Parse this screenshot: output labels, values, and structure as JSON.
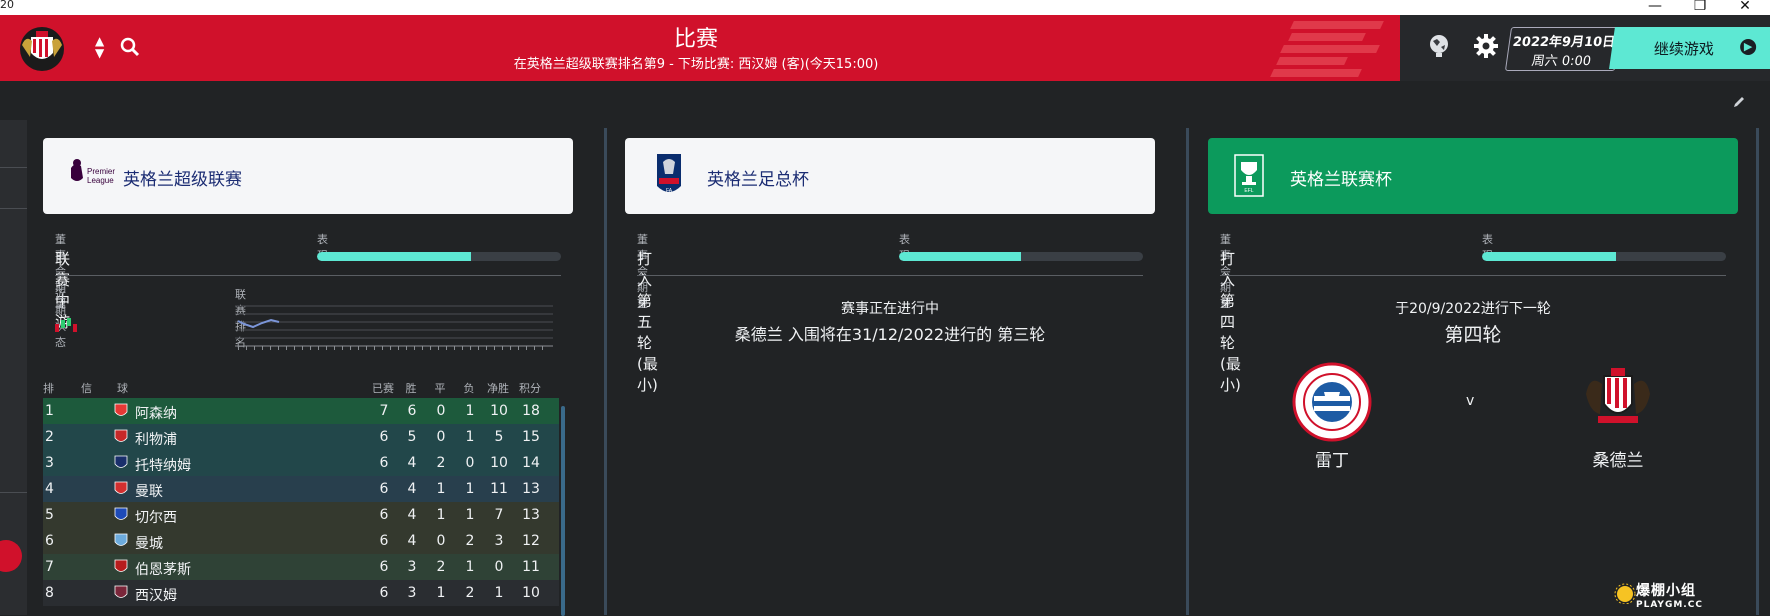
{
  "window": {
    "corner_text": "20",
    "minimize": "—",
    "restore": "❐",
    "close": "✕"
  },
  "header": {
    "title": "比赛",
    "subtitle": "在英格兰超级联赛排名第9 - 下场比赛: 西汉姆 (客)(今天15:00)",
    "date": "2022年9月10日",
    "time": "周六 0:00",
    "continue_label": "继续游戏",
    "icons": [
      "club-crest-icon",
      "nav-arrows-icon",
      "search-icon",
      "world-ball-icon",
      "settings-gear-icon",
      "chevron-right-icon"
    ]
  },
  "colors": {
    "header_red": "#d0112b",
    "accent_teal": "#5de8d3",
    "league_cup_green": "#0c9a5c",
    "background": "#212325"
  },
  "premier_league": {
    "name": "英格兰超级联赛",
    "logo_text": "Premier League",
    "expectation_label": "董事会期望",
    "expectation": "联赛中游",
    "performance_label": "表现",
    "performance": 0.63,
    "form_label": "近期状态",
    "position_label": "联赛排名",
    "table_headers": {
      "pos": "排名",
      "info": "信息",
      "team": "球队",
      "played": "已赛",
      "won": "胜",
      "drawn": "平",
      "lost": "负",
      "gd": "净胜",
      "pts": "积分"
    },
    "table": [
      {
        "pos": "1",
        "team": "阿森纳",
        "p": "7",
        "w": "6",
        "d": "0",
        "l": "1",
        "gd": "10",
        "pts": "18",
        "color": "#e53935"
      },
      {
        "pos": "2",
        "team": "利物浦",
        "p": "6",
        "w": "5",
        "d": "0",
        "l": "1",
        "gd": "5",
        "pts": "15",
        "color": "#c62828"
      },
      {
        "pos": "3",
        "team": "托特纳姆",
        "p": "6",
        "w": "4",
        "d": "2",
        "l": "0",
        "gd": "10",
        "pts": "14",
        "color": "#1a2f6b"
      },
      {
        "pos": "4",
        "team": "曼联",
        "p": "6",
        "w": "4",
        "d": "1",
        "l": "1",
        "gd": "11",
        "pts": "13",
        "color": "#d32f2f"
      },
      {
        "pos": "5",
        "team": "切尔西",
        "p": "6",
        "w": "4",
        "d": "1",
        "l": "1",
        "gd": "7",
        "pts": "13",
        "color": "#1e4bb8"
      },
      {
        "pos": "6",
        "team": "曼城",
        "p": "6",
        "w": "4",
        "d": "0",
        "l": "2",
        "gd": "3",
        "pts": "12",
        "color": "#6cabdd"
      },
      {
        "pos": "7",
        "team": "伯恩茅斯",
        "p": "6",
        "w": "3",
        "d": "2",
        "l": "1",
        "gd": "0",
        "pts": "11",
        "color": "#b71c1c"
      },
      {
        "pos": "8",
        "team": "西汉姆",
        "p": "6",
        "w": "3",
        "d": "1",
        "l": "2",
        "gd": "1",
        "pts": "10",
        "color": "#7a263a"
      }
    ]
  },
  "fa_cup": {
    "name": "英格兰足总杯",
    "expectation_label": "董事会期望",
    "expectation": "打入 第五轮 (最小)",
    "performance_label": "表现",
    "performance": 0.5,
    "status": "赛事正在进行中",
    "detail": "桑德兰 入围将在31/12/2022进行的 第三轮"
  },
  "league_cup": {
    "name": "英格兰联赛杯",
    "expectation_label": "董事会期望",
    "expectation": "打入 第四轮 (最小)",
    "performance_label": "表现",
    "performance": 0.55,
    "next_round_date": "于20/9/2022进行下一轮",
    "round": "第四轮",
    "home": "雷丁",
    "vs": "v",
    "away": "桑德兰"
  },
  "watermark": {
    "line1": "爆棚小组",
    "line2": "PLAYGM.CC"
  }
}
